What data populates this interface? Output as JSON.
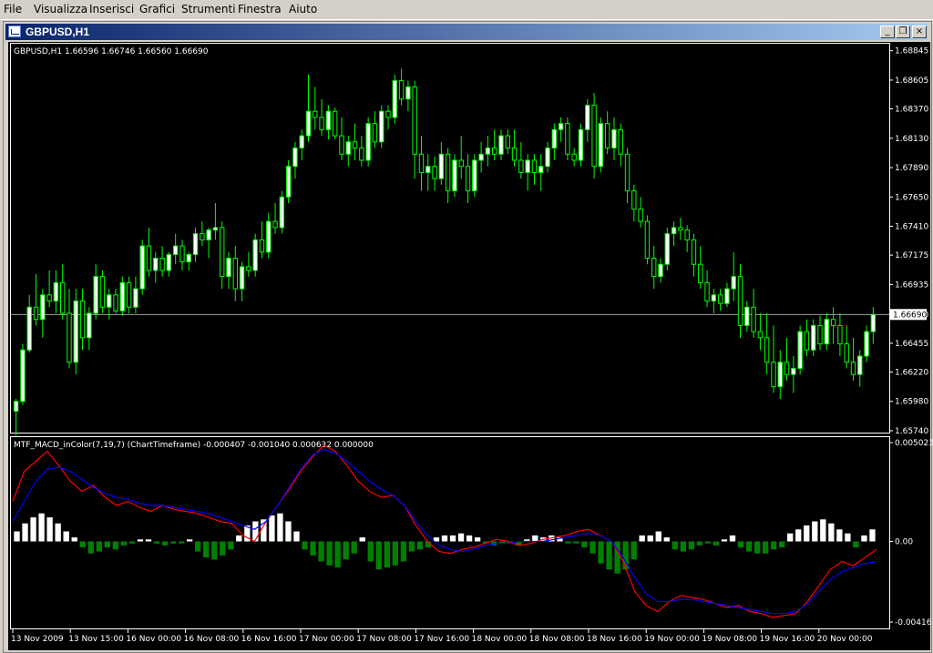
{
  "menu": [
    "File",
    "Visualizza",
    "Inserisci",
    "Grafici",
    "Strumenti",
    "Finestra",
    "Aiuto"
  ],
  "window": {
    "title": "GBPUSD,H1",
    "minimize_label": "_",
    "restore_label": "❒",
    "close_label": "×"
  },
  "main_panel": {
    "header": "GBPUSD,H1  1.66596 1.66746 1.66560 1.66690",
    "price_labels": [
      "1.68845",
      "1.68605",
      "1.68370",
      "1.68130",
      "1.67890",
      "1.67650",
      "1.67410",
      "1.67175",
      "1.66935",
      "1.66690",
      "1.66455",
      "1.66220",
      "1.65980",
      "1.65740"
    ],
    "current_price": "1.66690"
  },
  "indicator_panel": {
    "header": "MTF_MACD_inColor(7,19,7) (ChartTimeframe) -0.000407 -0.001040 0.000632 0.000000",
    "scale_labels": [
      "0.005023",
      "0.00",
      "-0.00416"
    ]
  },
  "time_labels": [
    "13 Nov 2009",
    "13 Nov 15:00",
    "16 Nov 00:00",
    "16 Nov 08:00",
    "16 Nov 16:00",
    "17 Nov 00:00",
    "17 Nov 08:00",
    "17 Nov 16:00",
    "18 Nov 00:00",
    "18 Nov 08:00",
    "18 Nov 16:00",
    "19 Nov 00:00",
    "19 Nov 08:00",
    "19 Nov 16:00",
    "20 Nov 00:00"
  ],
  "colors": {
    "background": "#000000",
    "bull_candle": "#ffffff",
    "bear_candle": "#000000",
    "wick": "#00ff00",
    "macd_red": "#ff0000",
    "macd_blue": "#0000ff",
    "hist_pos": "#ffffff",
    "hist_neg": "#008000"
  },
  "chart_data": [
    {
      "type": "candlestick",
      "title": "GBPUSD,H1",
      "ylim": [
        1.6574,
        1.6885
      ],
      "close_line": 1.6669,
      "candles": [
        [
          1.659,
          1.66,
          1.657,
          1.6598
        ],
        [
          1.6598,
          1.6645,
          1.6595,
          1.664
        ],
        [
          1.664,
          1.6685,
          1.6638,
          1.6675
        ],
        [
          1.6675,
          1.6702,
          1.666,
          1.6665
        ],
        [
          1.6665,
          1.669,
          1.665,
          1.6685
        ],
        [
          1.6685,
          1.6705,
          1.6675,
          1.668
        ],
        [
          1.668,
          1.6705,
          1.667,
          1.6695
        ],
        [
          1.6695,
          1.671,
          1.6665,
          1.667
        ],
        [
          1.667,
          1.669,
          1.6625,
          1.663
        ],
        [
          1.663,
          1.669,
          1.662,
          1.668
        ],
        [
          1.668,
          1.669,
          1.664,
          1.665
        ],
        [
          1.665,
          1.6675,
          1.664,
          1.667
        ],
        [
          1.667,
          1.671,
          1.6665,
          1.67
        ],
        [
          1.67,
          1.6705,
          1.667,
          1.6675
        ],
        [
          1.6675,
          1.669,
          1.6665,
          1.6685
        ],
        [
          1.6685,
          1.669,
          1.667,
          1.6672
        ],
        [
          1.6672,
          1.67,
          1.6668,
          1.6695
        ],
        [
          1.6695,
          1.67,
          1.667,
          1.6675
        ],
        [
          1.6675,
          1.67,
          1.667,
          1.669
        ],
        [
          1.669,
          1.673,
          1.6685,
          1.6725
        ],
        [
          1.6725,
          1.674,
          1.67,
          1.6705
        ],
        [
          1.6705,
          1.672,
          1.6695,
          1.6715
        ],
        [
          1.6715,
          1.6725,
          1.67,
          1.6705
        ],
        [
          1.6705,
          1.672,
          1.67,
          1.6718
        ],
        [
          1.6718,
          1.6735,
          1.671,
          1.6725
        ],
        [
          1.6725,
          1.673,
          1.6705,
          1.6712
        ],
        [
          1.6712,
          1.672,
          1.6705,
          1.6718
        ],
        [
          1.6718,
          1.674,
          1.6712,
          1.6735
        ],
        [
          1.6735,
          1.6745,
          1.6725,
          1.673
        ],
        [
          1.673,
          1.674,
          1.6715,
          1.6738
        ],
        [
          1.6738,
          1.676,
          1.673,
          1.674
        ],
        [
          1.674,
          1.6745,
          1.669,
          1.67
        ],
        [
          1.67,
          1.672,
          1.669,
          1.6715
        ],
        [
          1.6715,
          1.6725,
          1.668,
          1.669
        ],
        [
          1.669,
          1.6712,
          1.668,
          1.6708
        ],
        [
          1.6708,
          1.672,
          1.67,
          1.6705
        ],
        [
          1.6705,
          1.6735,
          1.67,
          1.673
        ],
        [
          1.673,
          1.6745,
          1.6715,
          1.672
        ],
        [
          1.672,
          1.6752,
          1.6715,
          1.6745
        ],
        [
          1.6745,
          1.676,
          1.6735,
          1.674
        ],
        [
          1.674,
          1.677,
          1.6735,
          1.6765
        ],
        [
          1.6765,
          1.6795,
          1.676,
          1.679
        ],
        [
          1.679,
          1.681,
          1.678,
          1.6805
        ],
        [
          1.6805,
          1.682,
          1.6795,
          1.6815
        ],
        [
          1.6815,
          1.6865,
          1.681,
          1.6835
        ],
        [
          1.6835,
          1.6855,
          1.682,
          1.683
        ],
        [
          1.683,
          1.6845,
          1.6815,
          1.682
        ],
        [
          1.682,
          1.684,
          1.6812,
          1.6835
        ],
        [
          1.6835,
          1.6838,
          1.6812,
          1.6815
        ],
        [
          1.6815,
          1.683,
          1.6795,
          1.68
        ],
        [
          1.68,
          1.6815,
          1.679,
          1.681
        ],
        [
          1.681,
          1.6825,
          1.6795,
          1.6805
        ],
        [
          1.6805,
          1.6815,
          1.679,
          1.6795
        ],
        [
          1.6795,
          1.683,
          1.679,
          1.6825
        ],
        [
          1.6825,
          1.6835,
          1.6805,
          1.681
        ],
        [
          1.681,
          1.684,
          1.6805,
          1.6835
        ],
        [
          1.6835,
          1.684,
          1.682,
          1.683
        ],
        [
          1.683,
          1.6865,
          1.6825,
          1.686
        ],
        [
          1.686,
          1.687,
          1.684,
          1.6845
        ],
        [
          1.6845,
          1.686,
          1.6835,
          1.6855
        ],
        [
          1.6855,
          1.686,
          1.678,
          1.68
        ],
        [
          1.68,
          1.6815,
          1.677,
          1.6785
        ],
        [
          1.6785,
          1.68,
          1.677,
          1.679
        ],
        [
          1.679,
          1.6798,
          1.677,
          1.678
        ],
        [
          1.678,
          1.681,
          1.6775,
          1.68
        ],
        [
          1.68,
          1.6805,
          1.676,
          1.677
        ],
        [
          1.677,
          1.68,
          1.6765,
          1.6795
        ],
        [
          1.6795,
          1.6815,
          1.678,
          1.679
        ],
        [
          1.679,
          1.68,
          1.676,
          1.677
        ],
        [
          1.677,
          1.68,
          1.6765,
          1.6795
        ],
        [
          1.6795,
          1.681,
          1.6785,
          1.68
        ],
        [
          1.68,
          1.6815,
          1.679,
          1.6805
        ],
        [
          1.6805,
          1.682,
          1.6795,
          1.68
        ],
        [
          1.68,
          1.682,
          1.6795,
          1.6815
        ],
        [
          1.6815,
          1.682,
          1.68,
          1.6805
        ],
        [
          1.6805,
          1.682,
          1.679,
          1.6795
        ],
        [
          1.6795,
          1.681,
          1.678,
          1.6785
        ],
        [
          1.6785,
          1.68,
          1.677,
          1.6795
        ],
        [
          1.6795,
          1.68,
          1.6775,
          1.6785
        ],
        [
          1.6785,
          1.68,
          1.677,
          1.679
        ],
        [
          1.679,
          1.681,
          1.6785,
          1.6805
        ],
        [
          1.6805,
          1.6825,
          1.6795,
          1.682
        ],
        [
          1.682,
          1.683,
          1.681,
          1.6825
        ],
        [
          1.6825,
          1.683,
          1.6795,
          1.68
        ],
        [
          1.68,
          1.6805,
          1.679,
          1.6795
        ],
        [
          1.6795,
          1.6825,
          1.679,
          1.682
        ],
        [
          1.682,
          1.6845,
          1.681,
          1.684
        ],
        [
          1.684,
          1.685,
          1.678,
          1.679
        ],
        [
          1.679,
          1.683,
          1.6785,
          1.6825
        ],
        [
          1.6825,
          1.6835,
          1.68,
          1.6805
        ],
        [
          1.6805,
          1.683,
          1.6795,
          1.682
        ],
        [
          1.682,
          1.6825,
          1.679,
          1.68
        ],
        [
          1.68,
          1.6805,
          1.676,
          1.677
        ],
        [
          1.677,
          1.6775,
          1.6745,
          1.6755
        ],
        [
          1.6755,
          1.6765,
          1.674,
          1.6745
        ],
        [
          1.6745,
          1.675,
          1.671,
          1.6715
        ],
        [
          1.6715,
          1.6725,
          1.669,
          1.67
        ],
        [
          1.67,
          1.6715,
          1.6695,
          1.671
        ],
        [
          1.671,
          1.674,
          1.6705,
          1.6735
        ],
        [
          1.6735,
          1.6745,
          1.6725,
          1.674
        ],
        [
          1.674,
          1.6748,
          1.673,
          1.6738
        ],
        [
          1.6738,
          1.6742,
          1.672,
          1.673
        ],
        [
          1.673,
          1.6735,
          1.67,
          1.671
        ],
        [
          1.671,
          1.6725,
          1.669,
          1.6695
        ],
        [
          1.6695,
          1.6705,
          1.6675,
          1.668
        ],
        [
          1.668,
          1.669,
          1.667,
          1.6685
        ],
        [
          1.6685,
          1.669,
          1.6672,
          1.6678
        ],
        [
          1.6678,
          1.6695,
          1.6675,
          1.669
        ],
        [
          1.669,
          1.672,
          1.668,
          1.67
        ],
        [
          1.67,
          1.671,
          1.665,
          1.666
        ],
        [
          1.666,
          1.668,
          1.6655,
          1.6675
        ],
        [
          1.6675,
          1.669,
          1.665,
          1.6655
        ],
        [
          1.6655,
          1.667,
          1.664,
          1.665
        ],
        [
          1.665,
          1.667,
          1.662,
          1.663
        ],
        [
          1.663,
          1.666,
          1.6605,
          1.661
        ],
        [
          1.661,
          1.664,
          1.66,
          1.663
        ],
        [
          1.663,
          1.665,
          1.6615,
          1.662
        ],
        [
          1.662,
          1.6635,
          1.6605,
          1.6625
        ],
        [
          1.6625,
          1.666,
          1.662,
          1.6655
        ],
        [
          1.6655,
          1.6665,
          1.6635,
          1.664
        ],
        [
          1.664,
          1.6665,
          1.6635,
          1.666
        ],
        [
          1.666,
          1.6668,
          1.664,
          1.6645
        ],
        [
          1.6645,
          1.667,
          1.664,
          1.6665
        ],
        [
          1.6665,
          1.6675,
          1.6645,
          1.666
        ],
        [
          1.666,
          1.667,
          1.6635,
          1.6645
        ],
        [
          1.6645,
          1.666,
          1.6625,
          1.663
        ],
        [
          1.663,
          1.665,
          1.6615,
          1.662
        ],
        [
          1.662,
          1.664,
          1.661,
          1.6635
        ],
        [
          1.6635,
          1.666,
          1.663,
          1.6655
        ],
        [
          1.6655,
          1.6675,
          1.6645,
          1.6669
        ]
      ]
    },
    {
      "type": "line",
      "title": "MTF_MACD_inColor(7,19,7) (ChartTimeframe)",
      "ylim": [
        -0.00416,
        0.005023
      ],
      "series": [
        {
          "color": "red",
          "values": [
            0.002,
            0.0035,
            0.004,
            0.0045,
            0.0038,
            0.003,
            0.0025,
            0.0028,
            0.0022,
            0.0018,
            0.002,
            0.0017,
            0.0015,
            0.0018,
            0.0016,
            0.0015,
            0.0014,
            0.0012,
            0.001,
            0.0009,
            0.0003,
            0.0,
            0.001,
            0.0018,
            0.0026,
            0.0035,
            0.0042,
            0.0048,
            0.0045,
            0.0038,
            0.003,
            0.0025,
            0.0022,
            0.0023,
            0.0018,
            0.0008,
            0.0,
            -0.0005,
            -0.0006,
            -0.0004,
            -0.0003,
            -0.0001,
            0.0001,
            0.0,
            -0.0002,
            -0.0001,
            0.0001,
            0.0002,
            0.0003,
            0.0005,
            0.0006,
            0.0003,
            0.0,
            -0.001,
            -0.0025,
            -0.0032,
            -0.0035,
            -0.003,
            -0.0027,
            -0.0028,
            -0.0029,
            -0.0031,
            -0.0033,
            -0.0032,
            -0.0035,
            -0.0036,
            -0.0038,
            -0.0037,
            -0.0036,
            -0.003,
            -0.0022,
            -0.0014,
            -0.001,
            -0.0012,
            -0.0008,
            -0.0004
          ]
        },
        {
          "color": "blue",
          "values": [
            0.001,
            0.002,
            0.003,
            0.0036,
            0.0037,
            0.0035,
            0.0031,
            0.0027,
            0.0024,
            0.0022,
            0.0021,
            0.0019,
            0.0018,
            0.0018,
            0.0017,
            0.0016,
            0.0015,
            0.0014,
            0.0012,
            0.001,
            0.0008,
            0.0006,
            0.001,
            0.0018,
            0.0027,
            0.0036,
            0.0043,
            0.0046,
            0.0044,
            0.004,
            0.0035,
            0.003,
            0.0026,
            0.0023,
            0.0018,
            0.001,
            0.0003,
            -0.0002,
            -0.0004,
            -0.0005,
            -0.0004,
            -0.0002,
            -0.0001,
            -0.0001,
            0.0,
            0.0,
            0.0,
            0.0001,
            0.0002,
            0.0003,
            0.0004,
            0.0003,
            0.0,
            -0.0008,
            -0.0018,
            -0.0026,
            -0.003,
            -0.003,
            -0.0029,
            -0.0029,
            -0.003,
            -0.0031,
            -0.0032,
            -0.0033,
            -0.0034,
            -0.0035,
            -0.0036,
            -0.0036,
            -0.0035,
            -0.0031,
            -0.0025,
            -0.0019,
            -0.0015,
            -0.0013,
            -0.0011,
            -0.001
          ]
        }
      ],
      "histogram": [
        0.0005,
        0.0009,
        0.0012,
        0.0014,
        0.0012,
        0.0009,
        0.0005,
        0.0002,
        -0.0003,
        -0.0006,
        -0.0005,
        -0.0003,
        -0.0004,
        -0.0002,
        -0.0001,
        0.0001,
        0.0001,
        -0.0001,
        -0.0002,
        -0.0001,
        -0.0001,
        0.0001,
        -0.0005,
        -0.0008,
        -0.0009,
        -0.0007,
        -0.0004,
        0.0003,
        0.0008,
        0.001,
        0.0011,
        0.0013,
        0.0014,
        0.001,
        0.0005,
        -0.0004,
        -0.0007,
        -0.001,
        -0.0012,
        -0.0013,
        -0.0009,
        -0.0006,
        0.0002,
        -0.001,
        -0.0014,
        -0.0013,
        -0.0012,
        -0.001,
        -0.0005,
        -0.0004,
        -0.0003,
        0.0002,
        0.0003,
        0.0003,
        0.0004,
        0.0003,
        0.0002,
        -0.0001,
        -0.0002,
        -0.0001,
        -0.0001,
        -0.0002,
        0.0001,
        0.0003,
        0.0002,
        0.0003,
        0.0002,
        -0.0001,
        -0.0001,
        -0.0003,
        -0.0006,
        -0.0011,
        -0.0014,
        -0.0016,
        -0.0014,
        -0.0009,
        0.0003,
        0.0003,
        0.0005,
        0.0002,
        -0.0004,
        -0.0005,
        -0.0004,
        -0.0002,
        -0.0001,
        -0.0002,
        0.0001,
        0.0003,
        -0.0003,
        -0.0005,
        -0.0006,
        -0.0006,
        -0.0004,
        -0.0003,
        0.0004,
        0.0006,
        0.0008,
        0.001,
        0.0011,
        0.0009,
        0.0006,
        0.0004,
        -0.0003,
        0.0003,
        0.0006
      ]
    }
  ]
}
